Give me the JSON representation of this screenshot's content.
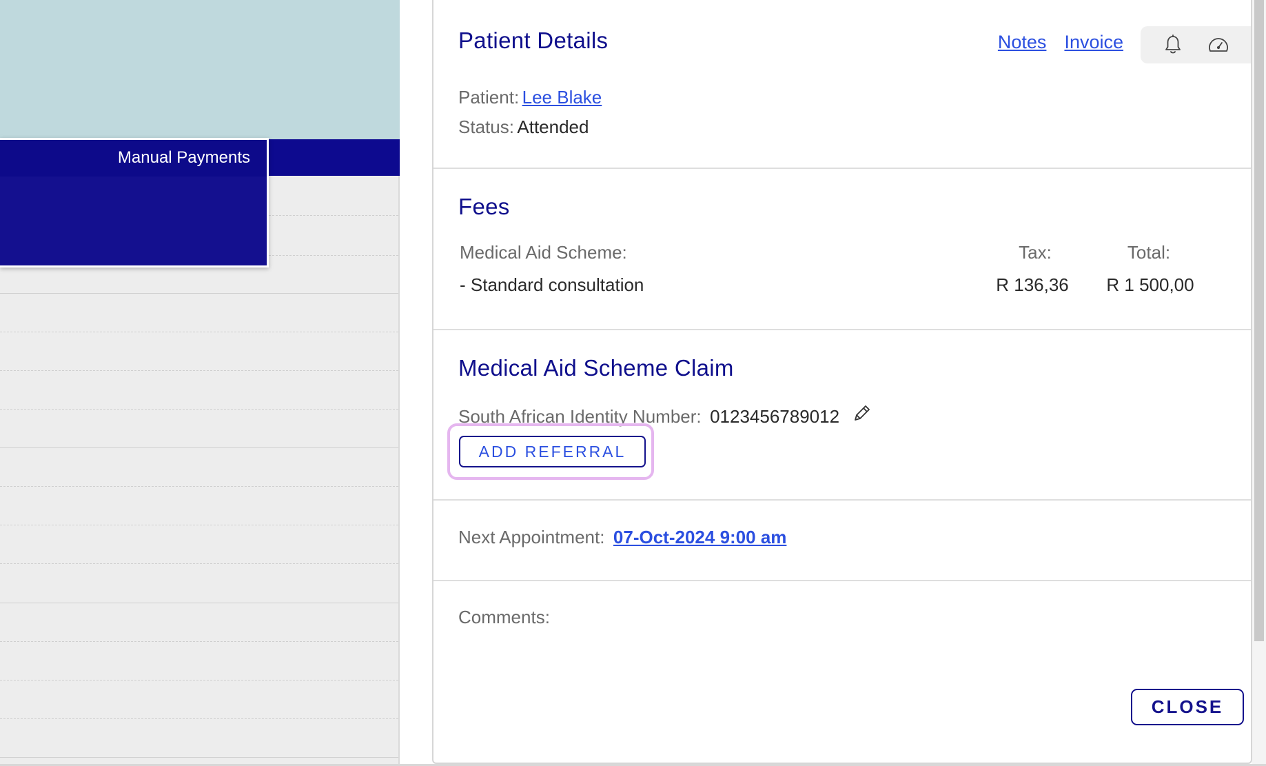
{
  "background": {
    "manual_payments_label": "Manual Payments"
  },
  "header": {
    "title": "Patient Details",
    "links": {
      "notes": "Notes",
      "invoice": "Invoice"
    },
    "icons": [
      "bell-icon",
      "speedometer-icon"
    ]
  },
  "patient": {
    "patient_label": "Patient:",
    "patient_name": "Lee Blake",
    "status_label": "Status:",
    "status_value": "Attended"
  },
  "fees": {
    "title": "Fees",
    "headers": {
      "description": "Medical Aid Scheme:",
      "tax": "Tax:",
      "total": "Total:"
    },
    "items": [
      {
        "description": "- Standard consultation",
        "tax": "R 136,36",
        "total": "R 1 500,00"
      }
    ]
  },
  "claim": {
    "title": "Medical Aid Scheme Claim",
    "id_label": "South African Identity Number:",
    "id_value": "0123456789012",
    "add_referral_label": "ADD REFERRAL",
    "edit_icon": "pencil-icon"
  },
  "appointment": {
    "label": "Next Appointment:",
    "value": "07-Oct-2024 9:00 am"
  },
  "comments": {
    "label": "Comments:"
  },
  "footer": {
    "close_label": "CLOSE"
  },
  "colors": {
    "title": "#0f0f8c",
    "link": "#2b4fe0",
    "nav": "#0d0a8f",
    "teal": "#bfd9dd",
    "highlight": "#e5b6ef"
  }
}
